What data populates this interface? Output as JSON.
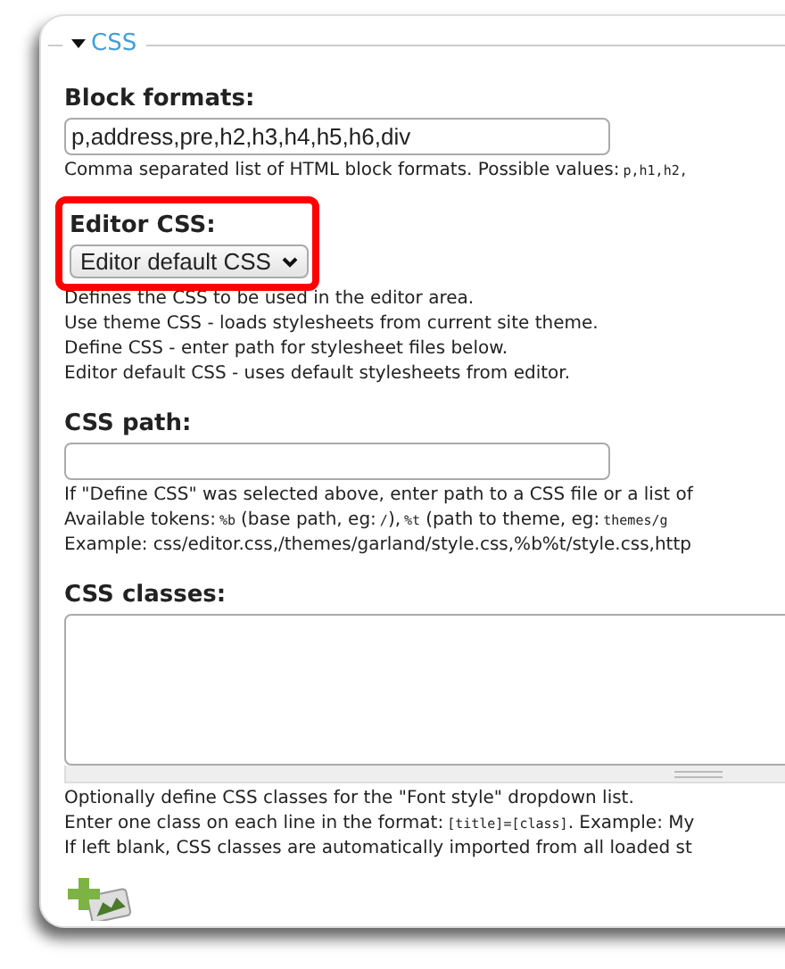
{
  "fieldset": {
    "legend": "CSS",
    "expanded": true
  },
  "fields": [
    {
      "kind": "text",
      "label": "Block formats:",
      "value": "p,address,pre,h2,h3,h4,h5,h6,div",
      "highlighted": false,
      "help": [
        [
          {
            "kind": "plain",
            "text": "Comma separated list of HTML block formats. Possible values:"
          },
          {
            "kind": "code",
            "text": "p,h1,h2,"
          }
        ]
      ]
    },
    {
      "kind": "select",
      "label": "Editor CSS:",
      "value": "Editor default CSS",
      "highlighted": true,
      "help": [
        [
          {
            "kind": "plain",
            "text": "Defines the CSS to be used in the editor area."
          }
        ],
        [
          {
            "kind": "plain",
            "text": "Use theme CSS - loads stylesheets from current site theme."
          }
        ],
        [
          {
            "kind": "plain",
            "text": "Define CSS - enter path for stylesheet files below."
          }
        ],
        [
          {
            "kind": "plain",
            "text": "Editor default CSS - uses default stylesheets from editor."
          }
        ]
      ]
    },
    {
      "kind": "text",
      "label": "CSS path:",
      "highlighted": false,
      "help": [
        [
          {
            "kind": "plain",
            "text": "If \"Define CSS\" was selected above, enter path to a CSS file or a list of"
          }
        ],
        [
          {
            "kind": "plain",
            "text": "Available tokens:"
          },
          {
            "kind": "code",
            "text": "%b"
          },
          {
            "kind": "plain",
            "text": "(base path, eg:"
          },
          {
            "kind": "code",
            "text": "/"
          },
          {
            "kind": "plain",
            "text": "),"
          },
          {
            "kind": "code",
            "text": "%t"
          },
          {
            "kind": "plain",
            "text": "(path to theme, eg:"
          },
          {
            "kind": "code",
            "text": "themes/g"
          }
        ],
        [
          {
            "kind": "plain",
            "text": "Example: css/editor.css,/themes/garland/style.css,%b%t/style.css,http"
          }
        ]
      ]
    },
    {
      "kind": "textarea",
      "label": "CSS classes:",
      "highlighted": false,
      "help": [
        [
          {
            "kind": "plain",
            "text": "Optionally define CSS classes for the \"Font style\" dropdown list."
          }
        ],
        [
          {
            "kind": "plain",
            "text": "Enter one class on each line in the format:"
          },
          {
            "kind": "code",
            "text": "[title]=[class]"
          },
          {
            "kind": "plain",
            "text": ". Example: My"
          }
        ],
        [
          {
            "kind": "plain",
            "text": "If left blank, CSS classes are automatically imported from all loaded st"
          }
        ]
      ]
    }
  ]
}
